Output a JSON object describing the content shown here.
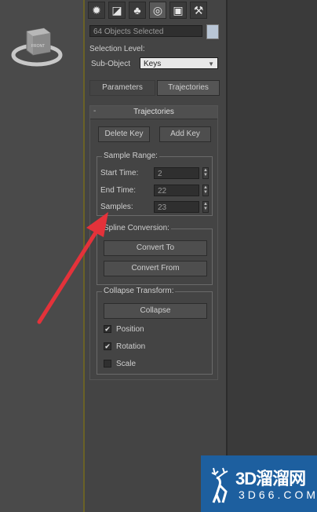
{
  "toolbar": {
    "icons": [
      "create-icon",
      "modify-icon",
      "hierarchy-icon",
      "motion-icon",
      "display-icon",
      "utilities-icon"
    ],
    "active": "motion-icon"
  },
  "selection": {
    "name_value": "64 Objects Selected",
    "color_swatch": "#b9c6d6"
  },
  "selection_level": {
    "label": "Selection Level:",
    "subobject_label": "Sub-Object",
    "subobject_value": "Keys"
  },
  "mode_tabs": {
    "parameters": "Parameters",
    "trajectories": "Trajectories"
  },
  "rollout": {
    "toggle": "-",
    "title": "Trajectories",
    "delete_key": "Delete Key",
    "add_key": "Add Key",
    "sample_range": {
      "title": "Sample Range:",
      "start_time_label": "Start Time:",
      "start_time_value": "2",
      "end_time_label": "End Time:",
      "end_time_value": "22",
      "samples_label": "Samples:",
      "samples_value": "23"
    },
    "spline_conversion": {
      "title": "Spline Conversion:",
      "convert_to": "Convert To",
      "convert_from": "Convert From"
    },
    "collapse_transform": {
      "title": "Collapse Transform:",
      "collapse": "Collapse",
      "position_label": "Position",
      "position_checked": true,
      "rotation_label": "Rotation",
      "rotation_checked": true,
      "scale_label": "Scale",
      "scale_checked": false
    }
  },
  "viewcube": {
    "face_label": "FRONT"
  },
  "watermark": {
    "brand": "3D溜溜网",
    "url": "3D66.COM"
  },
  "colors": {
    "arrow": "#e4323a",
    "watermark_bg": "#1d5f9f"
  }
}
